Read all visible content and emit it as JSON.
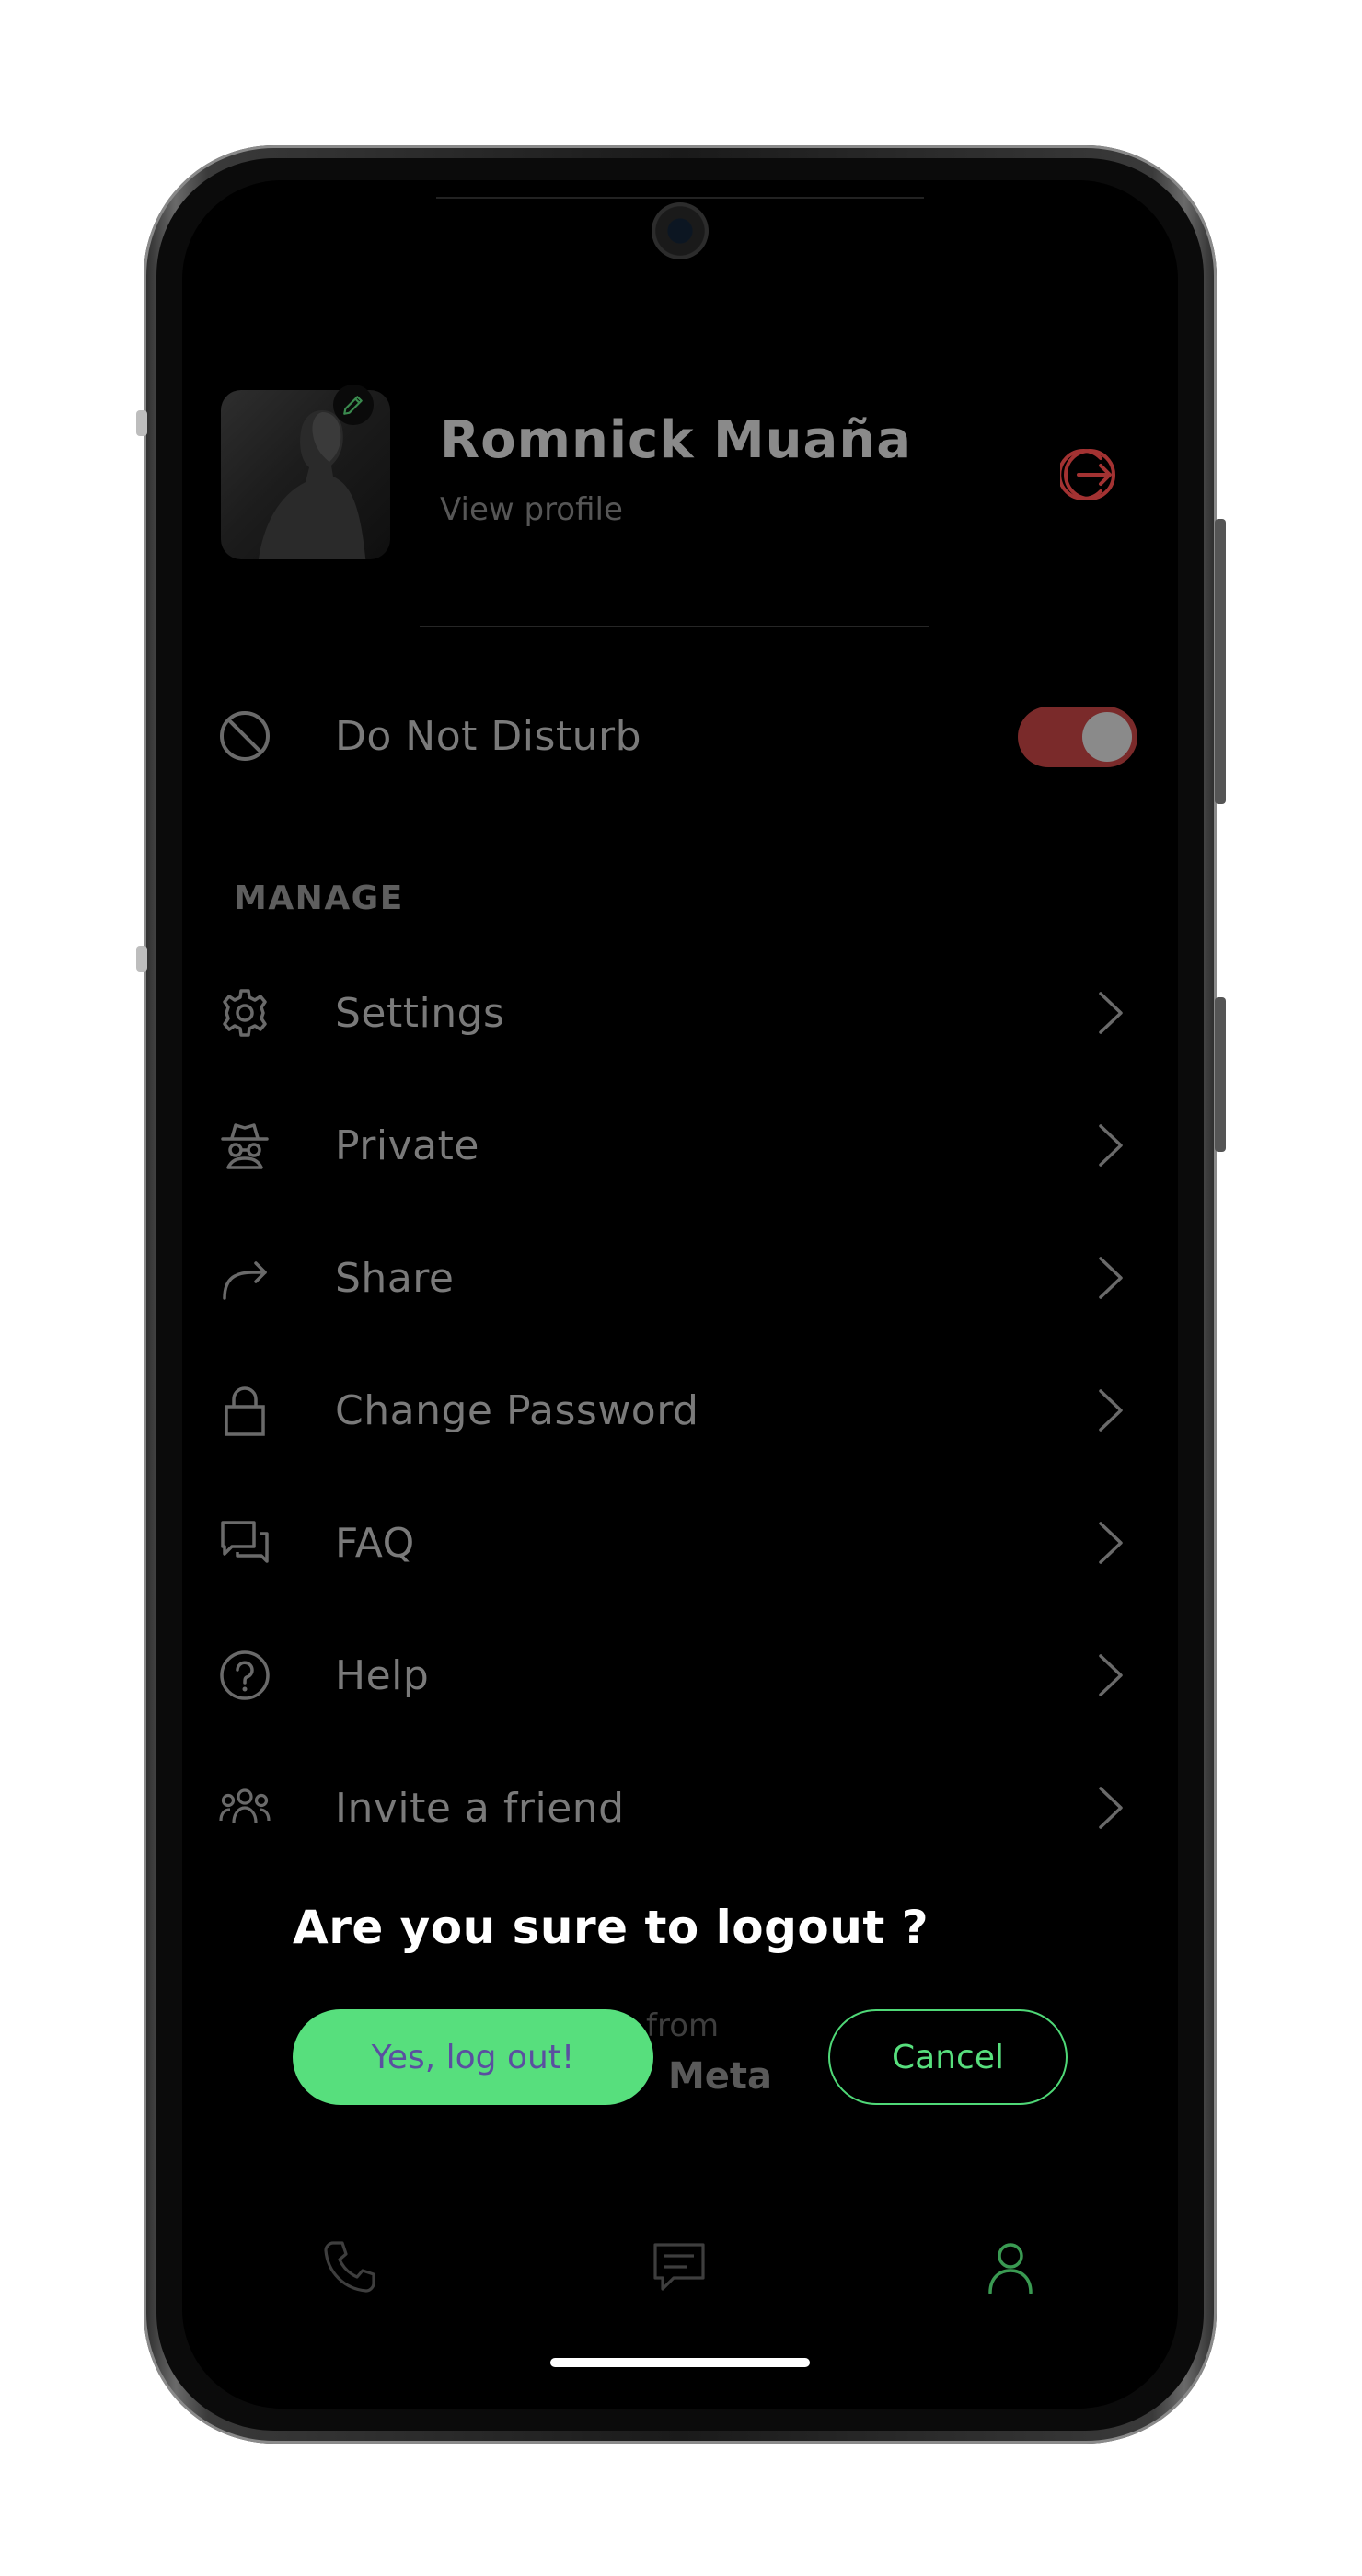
{
  "profile": {
    "name": "Romnick Muaña",
    "subtitle": "View profile"
  },
  "dnd": {
    "label": "Do Not Disturb",
    "enabled": true
  },
  "manage": {
    "section_label": "MANAGE",
    "items": [
      {
        "label": "Settings",
        "icon": "gear-icon"
      },
      {
        "label": "Private",
        "icon": "incognito-icon"
      },
      {
        "label": "Share",
        "icon": "share-arrow-icon"
      },
      {
        "label": "Change Password",
        "icon": "lock-icon"
      },
      {
        "label": "FAQ",
        "icon": "chat-bubbles-icon"
      },
      {
        "label": "Help",
        "icon": "help-circle-icon"
      },
      {
        "label": "Invite a friend",
        "icon": "group-icon"
      }
    ]
  },
  "footer": {
    "from": "from",
    "brand": "Meta"
  },
  "dialog": {
    "title": "Are you sure to logout ?",
    "confirm": "Yes, log out!",
    "cancel": "Cancel"
  },
  "nav": {
    "items": [
      {
        "icon": "phone-icon",
        "active": false
      },
      {
        "icon": "message-icon",
        "active": false
      },
      {
        "icon": "person-icon",
        "active": true
      }
    ]
  },
  "colors": {
    "accent_green": "#57df7d",
    "danger_red": "#7a2a2a",
    "background": "#000000"
  }
}
